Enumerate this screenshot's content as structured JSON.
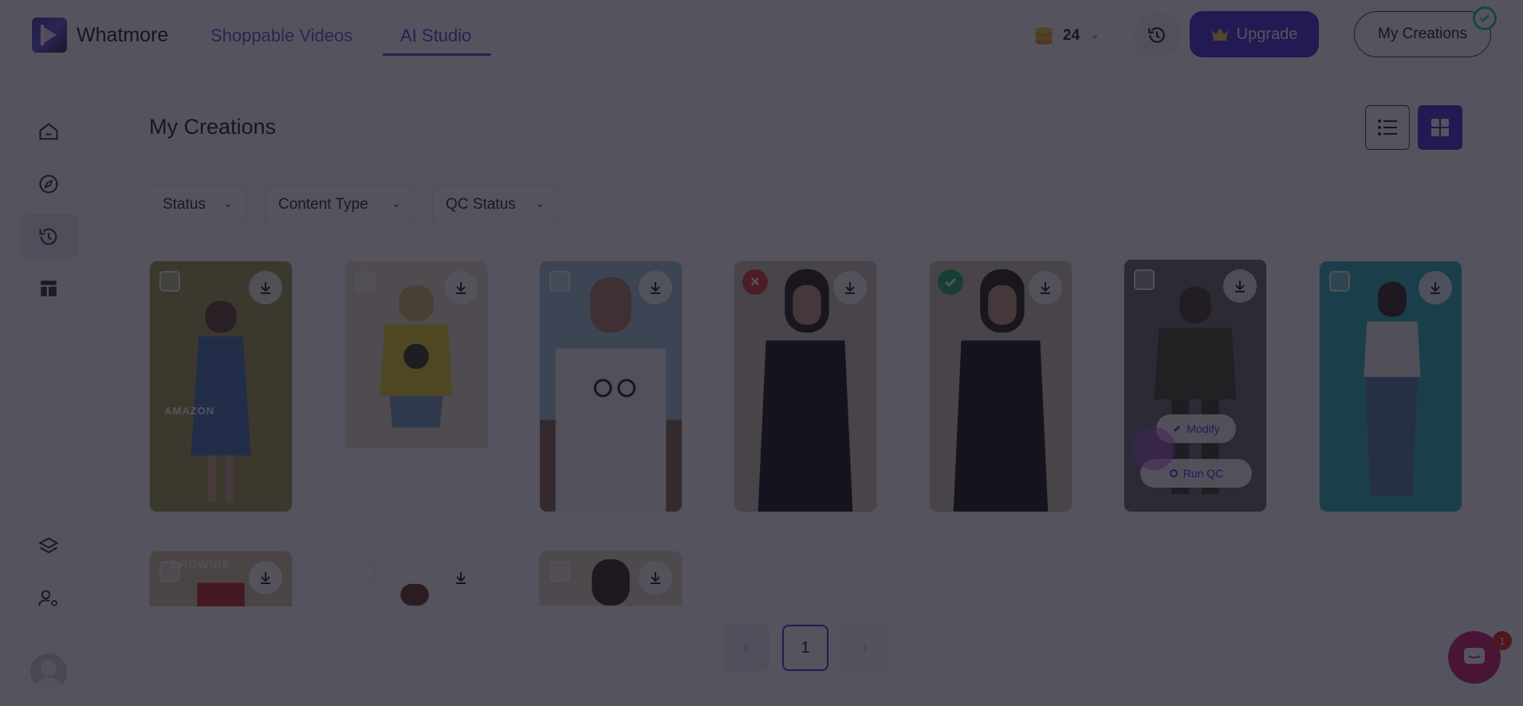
{
  "header": {
    "brand": "Whatmore",
    "nav": [
      {
        "label": "Shoppable Videos",
        "active": false
      },
      {
        "label": "AI Studio",
        "active": true
      }
    ],
    "coins": "24",
    "upgrade_label": "Upgrade",
    "my_creations_label": "My Creations"
  },
  "sidebar": {
    "items": [
      {
        "icon": "home-icon",
        "active": false
      },
      {
        "icon": "compass-icon",
        "active": false
      },
      {
        "icon": "history-icon",
        "active": true
      },
      {
        "icon": "layout-icon",
        "active": false
      },
      {
        "icon": "layers-icon",
        "active": false
      },
      {
        "icon": "user-settings-icon",
        "active": false
      }
    ]
  },
  "main": {
    "title": "My Creations",
    "filters": [
      {
        "label": "Status"
      },
      {
        "label": "Content Type"
      },
      {
        "label": "QC Status"
      }
    ],
    "cards": [
      {
        "status": "none",
        "image_text": "AMAZON"
      },
      {
        "status": "none"
      },
      {
        "status": "none"
      },
      {
        "status": "rejected"
      },
      {
        "status": "approved"
      },
      {
        "status": "hover",
        "actions": [
          "Modify",
          "Run QC"
        ]
      },
      {
        "status": "none"
      },
      {
        "status": "none",
        "image_text": "BROWNIE"
      },
      {
        "status": "none"
      },
      {
        "status": "none"
      }
    ]
  },
  "pagination": {
    "current": "1",
    "prev": "‹",
    "next": "›"
  },
  "chat": {
    "unread": "1"
  },
  "colors": {
    "accent": "#4a2fd8",
    "approved": "#27b36a",
    "rejected": "#e23b3b"
  }
}
